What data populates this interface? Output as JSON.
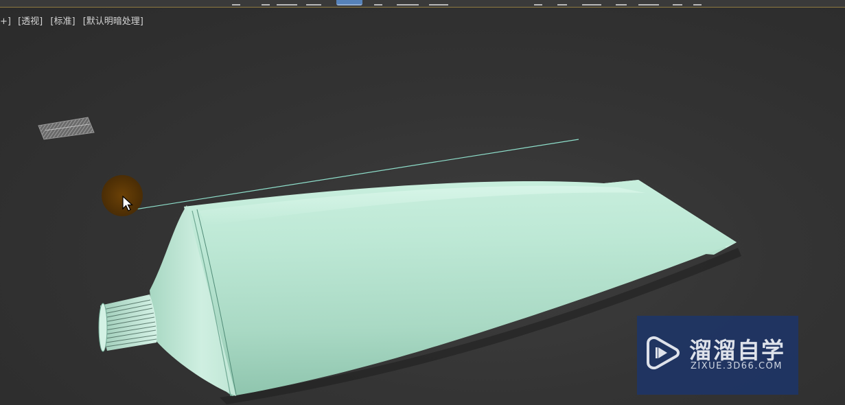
{
  "viewport": {
    "labels": [
      "+]",
      "[透视]",
      "[标准]",
      "[默认明暗处理]"
    ]
  },
  "scene": {
    "object": "toothpaste-tube",
    "object_color": "#bfe8d6",
    "background_color": "#333333",
    "line_color": "#8fe0cc"
  },
  "cursor": {
    "highlight_color": "#5b3705"
  },
  "watermark": {
    "title": "溜溜自学",
    "url": "ZIXUE.3D66.COM",
    "background_color": "#1f3564"
  }
}
